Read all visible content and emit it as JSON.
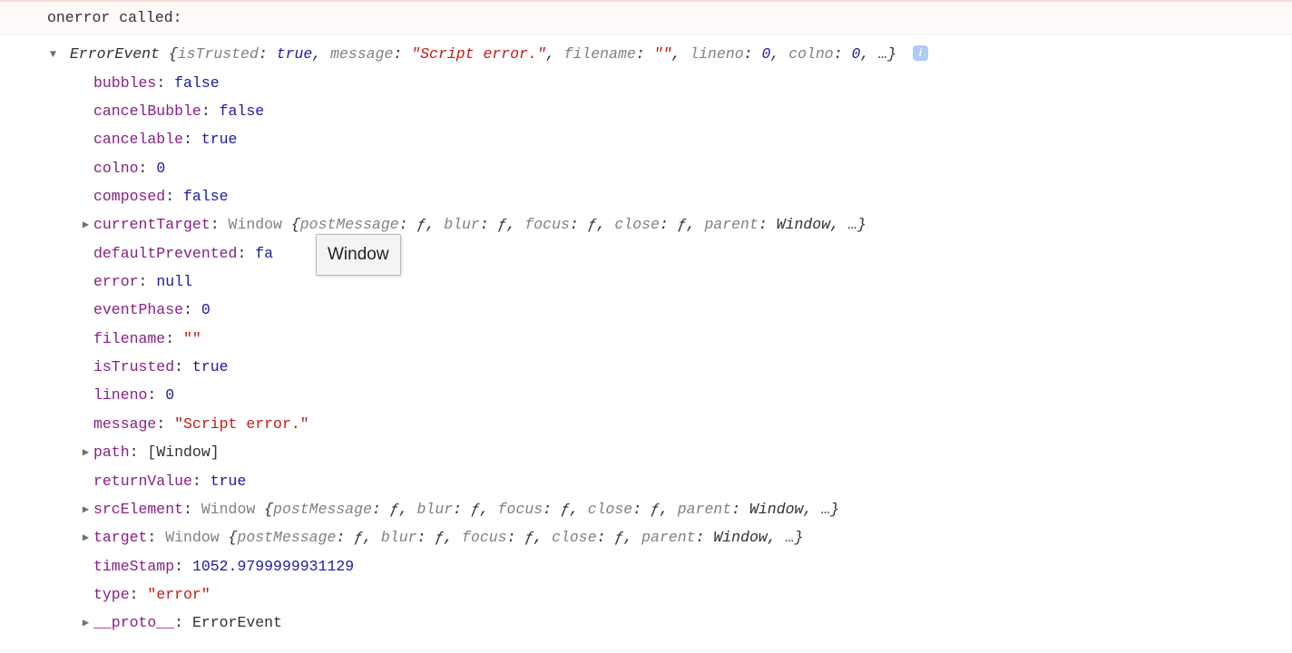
{
  "header_text": "onerror called:",
  "top_type": "ErrorEvent",
  "top_summary": [
    {
      "k": "isTrusted",
      "v": "true",
      "t": "bool"
    },
    {
      "k": "message",
      "v": "\"Script error.\"",
      "t": "string"
    },
    {
      "k": "filename",
      "v": "\"\"",
      "t": "string"
    },
    {
      "k": "lineno",
      "v": "0",
      "t": "num"
    },
    {
      "k": "colno",
      "v": "0",
      "t": "num"
    }
  ],
  "info_badge": "i",
  "rows": [
    {
      "arrow": "",
      "k": "bubbles",
      "sep": ": ",
      "v": "false",
      "vt": "bool"
    },
    {
      "arrow": "",
      "k": "cancelBubble",
      "sep": ": ",
      "v": "false",
      "vt": "bool"
    },
    {
      "arrow": "",
      "k": "cancelable",
      "sep": ": ",
      "v": "true",
      "vt": "bool"
    },
    {
      "arrow": "",
      "k": "colno",
      "sep": ": ",
      "v": "0",
      "vt": "num"
    },
    {
      "arrow": "",
      "k": "composed",
      "sep": ": ",
      "v": "false",
      "vt": "bool"
    },
    {
      "arrow": ">",
      "k": "currentTarget",
      "sep": ": ",
      "v_type": "Window",
      "summary": [
        {
          "k": "postMessage",
          "v": "ƒ",
          "t": "func"
        },
        {
          "k": "blur",
          "v": "ƒ",
          "t": "func"
        },
        {
          "k": "focus",
          "v": "ƒ",
          "t": "func"
        },
        {
          "k": "close",
          "v": "ƒ",
          "t": "func"
        },
        {
          "k": "parent",
          "v": "Window",
          "t": "plain"
        }
      ]
    },
    {
      "arrow": "",
      "k": "defaultPrevented",
      "sep": ": ",
      "v": "fa",
      "vt": "bool_trunc",
      "tooltip": "Window"
    },
    {
      "arrow": "",
      "k": "error",
      "sep": ": ",
      "v": "null",
      "vt": "null"
    },
    {
      "arrow": "",
      "k": "eventPhase",
      "sep": ": ",
      "v": "0",
      "vt": "num"
    },
    {
      "arrow": "",
      "k": "filename",
      "sep": ": ",
      "v": "\"\"",
      "vt": "string"
    },
    {
      "arrow": "",
      "k": "isTrusted",
      "sep": ": ",
      "v": "true",
      "vt": "bool"
    },
    {
      "arrow": "",
      "k": "lineno",
      "sep": ": ",
      "v": "0",
      "vt": "num"
    },
    {
      "arrow": "",
      "k": "message",
      "sep": ": ",
      "v": "\"Script error.\"",
      "vt": "string"
    },
    {
      "arrow": ">",
      "k": "path",
      "sep": ": ",
      "v": "[Window]",
      "vt": "plain"
    },
    {
      "arrow": "",
      "k": "returnValue",
      "sep": ": ",
      "v": "true",
      "vt": "bool"
    },
    {
      "arrow": ">",
      "k": "srcElement",
      "sep": ": ",
      "v_type": "Window",
      "summary": [
        {
          "k": "postMessage",
          "v": "ƒ",
          "t": "func"
        },
        {
          "k": "blur",
          "v": "ƒ",
          "t": "func"
        },
        {
          "k": "focus",
          "v": "ƒ",
          "t": "func"
        },
        {
          "k": "close",
          "v": "ƒ",
          "t": "func"
        },
        {
          "k": "parent",
          "v": "Window",
          "t": "plain"
        }
      ]
    },
    {
      "arrow": ">",
      "k": "target",
      "sep": ": ",
      "v_type": "Window",
      "summary": [
        {
          "k": "postMessage",
          "v": "ƒ",
          "t": "func"
        },
        {
          "k": "blur",
          "v": "ƒ",
          "t": "func"
        },
        {
          "k": "focus",
          "v": "ƒ",
          "t": "func"
        },
        {
          "k": "close",
          "v": "ƒ",
          "t": "func"
        },
        {
          "k": "parent",
          "v": "Window",
          "t": "plain"
        }
      ]
    },
    {
      "arrow": "",
      "k": "timeStamp",
      "sep": ": ",
      "v": "1052.9799999931129",
      "vt": "num"
    },
    {
      "arrow": "",
      "k": "type",
      "sep": ": ",
      "v": "\"error\"",
      "vt": "string"
    },
    {
      "arrow": ">",
      "k": "__proto__",
      "sep": ": ",
      "v": "ErrorEvent",
      "vt": "plain"
    }
  ]
}
